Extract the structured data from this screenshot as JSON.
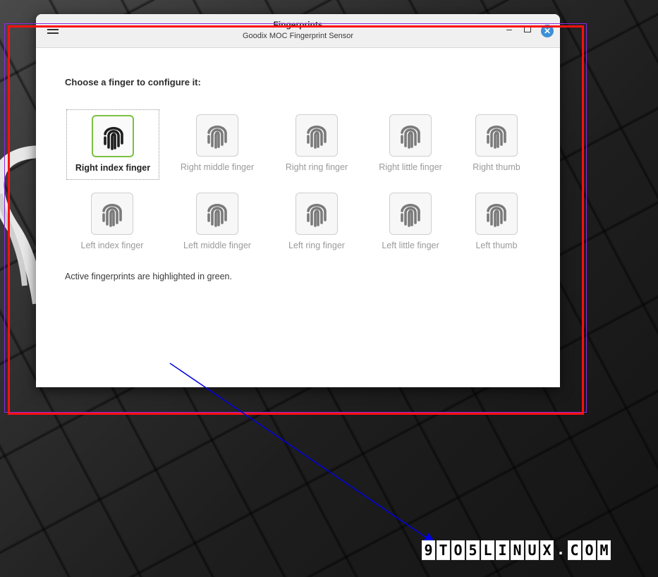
{
  "window": {
    "title": "Fingerprints",
    "subtitle": "Goodix MOC Fingerprint Sensor"
  },
  "content": {
    "prompt": "Choose a finger to configure it:",
    "footnote": "Active fingerprints are highlighted in green."
  },
  "fingers": [
    {
      "label": "Right index finger",
      "active": true
    },
    {
      "label": "Right middle finger",
      "active": false
    },
    {
      "label": "Right ring finger",
      "active": false
    },
    {
      "label": "Right little finger",
      "active": false
    },
    {
      "label": "Right thumb",
      "active": false
    },
    {
      "label": "Left index finger",
      "active": false
    },
    {
      "label": "Left middle finger",
      "active": false
    },
    {
      "label": "Left ring finger",
      "active": false
    },
    {
      "label": "Left little finger",
      "active": false
    },
    {
      "label": "Left thumb",
      "active": false
    }
  ],
  "watermark": {
    "text": "9TO5LINUX.COM"
  },
  "colors": {
    "active_border": "#7bc142",
    "annotation_box": "#ff1010",
    "annotation_arrow": "#0000e0",
    "close_button": "#3d8fd6"
  },
  "icons": {
    "finger": "fingerprint-icon",
    "menu": "hamburger-menu-icon",
    "close": "close-icon",
    "minimize": "minimize-icon",
    "maximize": "maximize-icon"
  }
}
